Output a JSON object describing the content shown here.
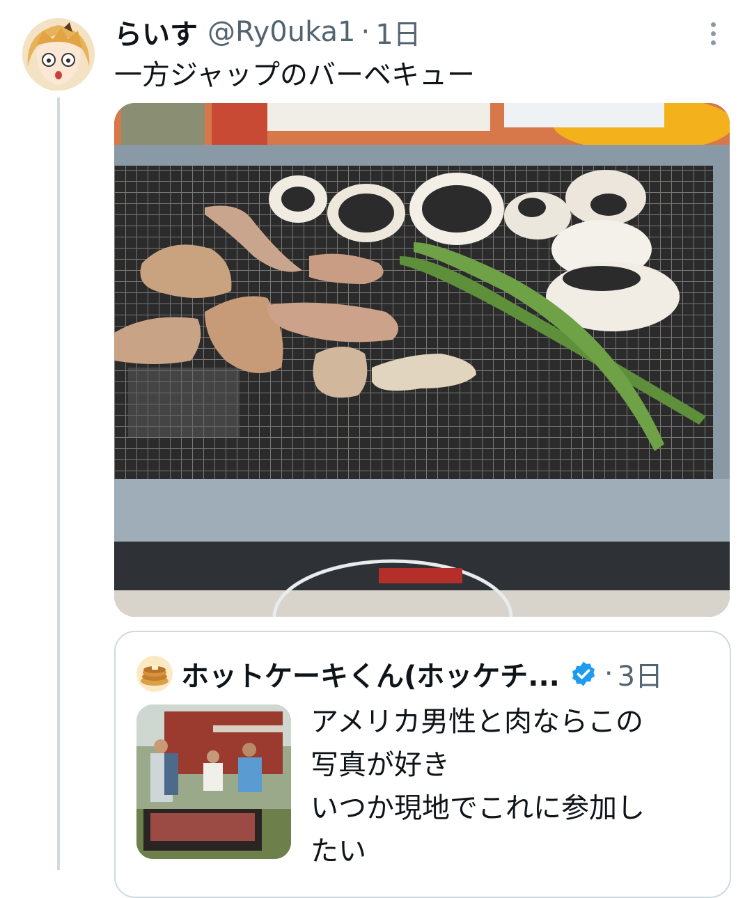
{
  "tweet": {
    "display_name": "らいす",
    "handle": "@Ry0uka1",
    "separator": "·",
    "time": "1日",
    "text": "一方ジャップのバーベキュー",
    "avatar_icon": "anime-character-avatar",
    "more_icon": "more-vertical-icon"
  },
  "quote_tweet": {
    "display_name": "ホットケーキくん(ホッケチ...",
    "verified_icon": "verified-badge-icon",
    "separator": "·",
    "time": "3日",
    "text_lines": [
      "アメリカ男性と肉ならこの",
      "写真が好き",
      "いつか現地でこれに参加し",
      "たい"
    ],
    "avatar_icon": "pancake-avatar"
  },
  "colors": {
    "text_primary": "#0f1419",
    "text_secondary": "#536471",
    "border": "#cfd9de",
    "verified": "#1d9bf0"
  }
}
